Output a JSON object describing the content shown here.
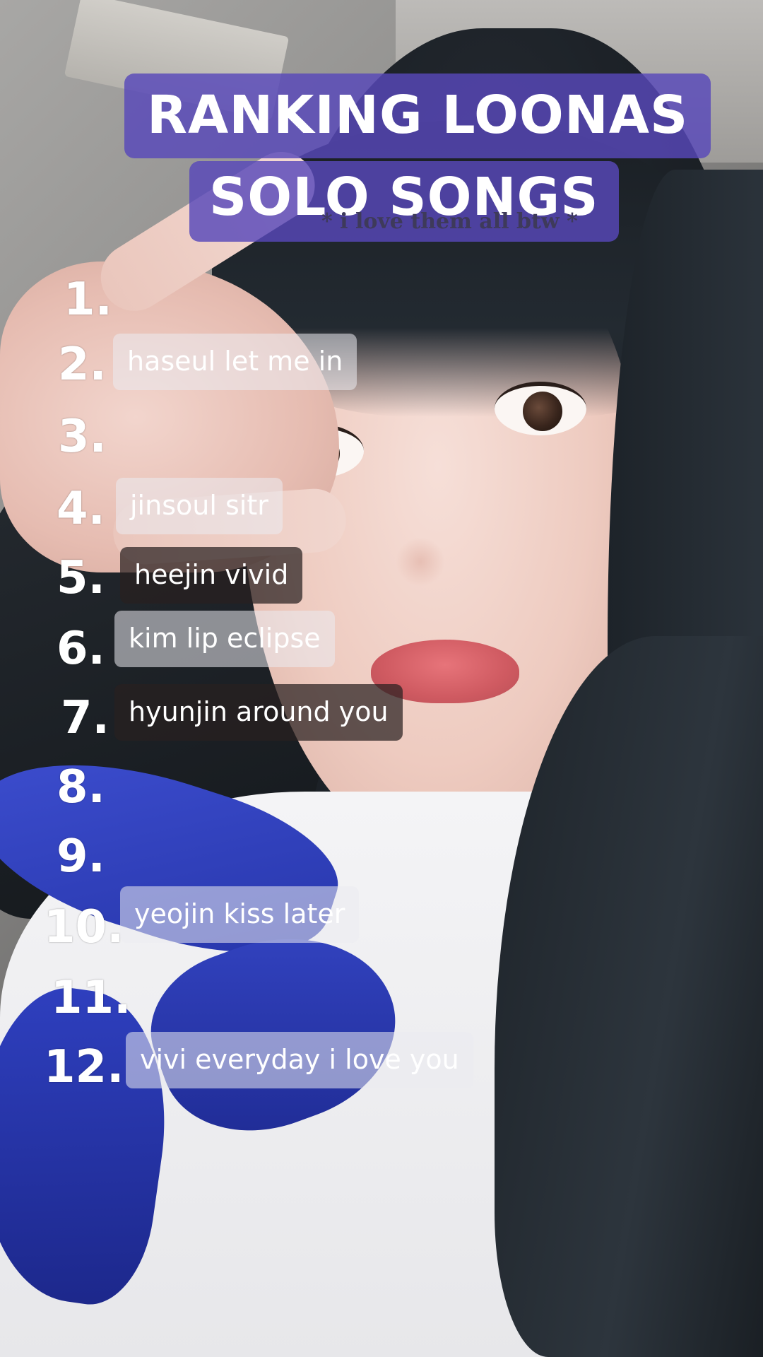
{
  "title": {
    "line1": "RANKING LOONAS",
    "line2": "SOLO SONGS",
    "subtitle": "* i love them all btw *"
  },
  "ranks": [
    "1.",
    "2.",
    "3.",
    "4.",
    "5.",
    "6.",
    "7.",
    "8.",
    "9.",
    "10.",
    "11.",
    "12."
  ],
  "songs": {
    "rank2": "haseul let me in",
    "rank4": "jinsoul sitr",
    "rank5": "heejin vivid",
    "rank6": "kim lip eclipse",
    "rank7": "hyunjin around you",
    "rank10": "yeojin kiss later",
    "rank12": "vivi everyday i love you"
  },
  "colors": {
    "title_box": "#5848BA",
    "label_light": "#EBEBF0",
    "label_dark": "#282020",
    "ribbon": "#3445C4"
  }
}
